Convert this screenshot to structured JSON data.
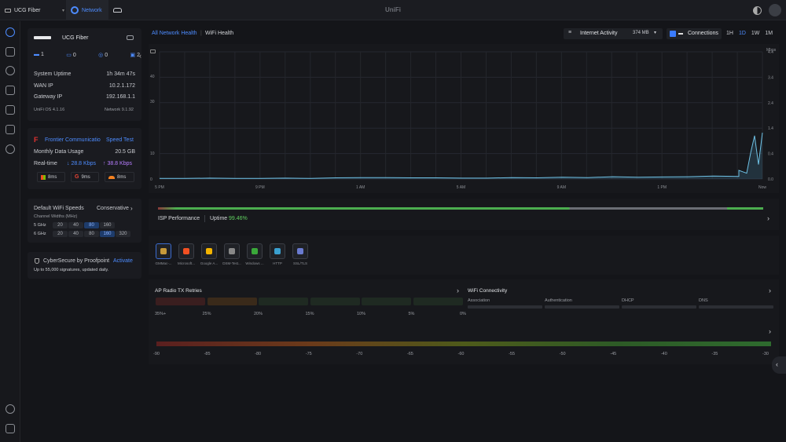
{
  "topbar": {
    "site_name": "UCG Fiber",
    "network_tab": "Network",
    "brand": "UniFi"
  },
  "device": {
    "name": "UCG Fiber",
    "stats": [
      "1",
      "0",
      "0",
      "2"
    ],
    "uptime_label": "System Uptime",
    "uptime_value": "1h 34m 47s",
    "wan_label": "WAN IP",
    "wan_value": "10.2.1.172",
    "gw_label": "Gateway IP",
    "gw_value": "192.168.1.1",
    "os_version": "UniFi OS 4.1.16",
    "net_version": "Network 9.1.92"
  },
  "isp": {
    "name": "Frontier Communicatio",
    "speed_test": "Speed Test",
    "monthly_label": "Monthly Data Usage",
    "monthly_value": "20.5 GB",
    "realtime_label": "Real-time",
    "down": "28.8 Kbps",
    "up": "38.8 Kbps",
    "latency": [
      "8ms",
      "9ms",
      "8ms"
    ]
  },
  "wifi": {
    "title": "Default WiFi Speeds",
    "mode": "Conservative",
    "subtitle": "Channel Widths (MHz)",
    "band5": "5 GHz",
    "band6": "6 GHz",
    "w5": [
      "20",
      "40",
      "80",
      "160"
    ],
    "w6": [
      "20",
      "40",
      "80",
      "160",
      "320"
    ]
  },
  "cyber": {
    "title": "CyberSecure by Proofpoint",
    "activate": "Activate",
    "desc": "Up to 55,000 signatures, updated daily."
  },
  "main": {
    "crumb_all": "All Network Health",
    "crumb_sep": "|",
    "crumb_current": "WiFi Health",
    "metric": "Internet Activity",
    "metric_total": "374 MB",
    "connections": "Connections",
    "ranges": [
      "1H",
      "1D",
      "1W",
      "1M"
    ],
    "active_range": "1D"
  },
  "chart_data": {
    "type": "area",
    "yunit": "Mbps",
    "yticks_left": [
      0,
      10,
      30,
      40
    ],
    "yticks_right": [
      "0.0",
      "0.4",
      "1.4",
      "2.4",
      "3.4",
      "4.4"
    ],
    "ylim": [
      0,
      4.4
    ],
    "x_labels": [
      "5 PM",
      "9 PM",
      "1 AM",
      "5 AM",
      "9 AM",
      "1 PM",
      "Now"
    ],
    "series": [
      {
        "values": [
          0.02,
          0.02,
          0.03,
          0.02,
          0.02,
          0.03,
          0.02,
          0.04,
          0.05,
          0.05,
          0.04,
          0.04,
          0.03,
          0.03,
          0.05,
          0.04,
          0.06,
          0.05,
          0.08,
          0.06,
          0.07,
          0.08,
          0.1,
          0.09,
          0.3,
          0.25,
          0.2,
          0.9,
          1.5,
          0.5,
          1.6
        ]
      }
    ]
  },
  "isp_perf": {
    "label": "ISP Performance",
    "uptime_label": "Uptime",
    "uptime_value": "99.46%"
  },
  "apps": [
    "GMMac-...",
    "Microsoft...",
    "Google A...",
    "DSM-Test...",
    "Windows ...",
    "HTTP",
    "SSL/TLS"
  ],
  "radio": {
    "title": "AP Radio TX Retries",
    "scale": [
      "35%+",
      "25%",
      "20%",
      "15%",
      "10%",
      "5%",
      "0%"
    ]
  },
  "conn": {
    "title": "WiFi Connectivity",
    "cols": [
      "Association",
      "Authentication",
      "DHCP",
      "DNS"
    ]
  },
  "signal_scale": [
    "-90",
    "-85",
    "-80",
    "-75",
    "-70",
    "-65",
    "-60",
    "-55",
    "-50",
    "-45",
    "-40",
    "-35",
    "-30"
  ]
}
